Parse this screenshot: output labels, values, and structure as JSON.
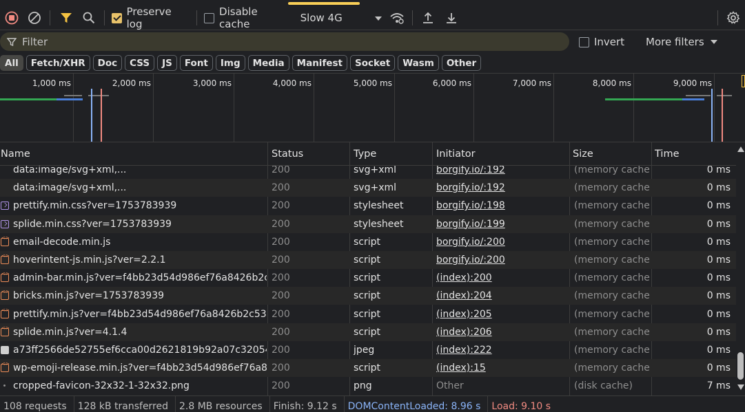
{
  "toolbar": {
    "preserve_log_label": "Preserve log",
    "disable_cache_label": "Disable cache",
    "throttle_value": "Slow 4G",
    "icons": [
      "stop-recording-icon",
      "clear-icon",
      "filter-icon",
      "search-icon",
      "network-conditions-icon",
      "import-icon",
      "export-icon",
      "settings-icon"
    ]
  },
  "filter": {
    "placeholder": "Filter",
    "invert_label": "Invert",
    "more_filters_label": "More filters"
  },
  "type_filters": [
    "All",
    "Fetch/XHR",
    "Doc",
    "CSS",
    "JS",
    "Font",
    "Img",
    "Media",
    "Manifest",
    "Socket",
    "Wasm",
    "Other"
  ],
  "overview": {
    "ticks": [
      "1,000 ms",
      "2,000 ms",
      "3,000 ms",
      "4,000 ms",
      "5,000 ms",
      "6,000 ms",
      "7,000 ms",
      "8,000 ms",
      "9,000 ms"
    ],
    "colors": {
      "green": "#34a853",
      "blue": "#4a7fd9",
      "domcontent": "#8ab4f8",
      "load": "#f28b82"
    }
  },
  "columns": {
    "name": "Name",
    "status": "Status",
    "type": "Type",
    "initiator": "Initiator",
    "size": "Size",
    "time": "Time"
  },
  "rows": [
    {
      "icon": "none",
      "name": "data:image/svg+xml,...",
      "status": "200",
      "type": "svg+xml",
      "initiator": "borgify.io/:192",
      "init_kind": "link",
      "size": "(memory cache)",
      "time": "0 ms"
    },
    {
      "icon": "none",
      "name": "data:image/svg+xml,...",
      "status": "200",
      "type": "svg+xml",
      "initiator": "borgify.io/:192",
      "init_kind": "link",
      "size": "(memory cache)",
      "time": "0 ms"
    },
    {
      "icon": "css",
      "name": "prettify.min.css?ver=1753783939",
      "status": "200",
      "type": "stylesheet",
      "initiator": "borgify.io/:198",
      "init_kind": "link",
      "size": "(memory cache)",
      "time": "0 ms"
    },
    {
      "icon": "css",
      "name": "splide.min.css?ver=1753783939",
      "status": "200",
      "type": "stylesheet",
      "initiator": "borgify.io/:199",
      "init_kind": "link",
      "size": "(memory cache)",
      "time": "0 ms"
    },
    {
      "icon": "js",
      "name": "email-decode.min.js",
      "status": "200",
      "type": "script",
      "initiator": "borgify.io/:200",
      "init_kind": "link",
      "size": "(memory cache)",
      "time": "0 ms"
    },
    {
      "icon": "js",
      "name": "hoverintent-js.min.js?ver=2.2.1",
      "status": "200",
      "type": "script",
      "initiator": "borgify.io/:200",
      "init_kind": "link",
      "size": "(memory cache)",
      "time": "0 ms"
    },
    {
      "icon": "js",
      "name": "admin-bar.min.js?ver=f4bb23d54d986ef76a8426b2c...",
      "status": "200",
      "type": "script",
      "initiator": "(index):200",
      "init_kind": "link",
      "size": "(memory cache)",
      "time": "0 ms"
    },
    {
      "icon": "js",
      "name": "bricks.min.js?ver=1753783939",
      "status": "200",
      "type": "script",
      "initiator": "(index):204",
      "init_kind": "link",
      "size": "(memory cache)",
      "time": "0 ms"
    },
    {
      "icon": "js",
      "name": "prettify.min.js?ver=f4bb23d54d986ef76a8426b2c534f...",
      "status": "200",
      "type": "script",
      "initiator": "(index):205",
      "init_kind": "link",
      "size": "(memory cache)",
      "time": "0 ms"
    },
    {
      "icon": "js",
      "name": "splide.min.js?ver=4.1.4",
      "status": "200",
      "type": "script",
      "initiator": "(index):206",
      "init_kind": "link",
      "size": "(memory cache)",
      "time": "0 ms"
    },
    {
      "icon": "img",
      "name": "a73ff2566de52755ef6cca00d2621819b92a07c320540...",
      "status": "200",
      "type": "jpeg",
      "initiator": "(index):222",
      "init_kind": "link",
      "size": "(memory cache)",
      "time": "0 ms"
    },
    {
      "icon": "js",
      "name": "wp-emoji-release.min.js?ver=f4bb23d54d986ef76a84...",
      "status": "200",
      "type": "script",
      "initiator": "(index):15",
      "init_kind": "link",
      "size": "(memory cache)",
      "time": "0 ms"
    },
    {
      "icon": "dot",
      "name": "cropped-favicon-32x32-1-32x32.png",
      "status": "200",
      "type": "png",
      "initiator": "Other",
      "init_kind": "other",
      "size": "(disk cache)",
      "time": "7 ms"
    }
  ],
  "status_bar": {
    "requests": "108 requests",
    "transferred": "128 kB transferred",
    "resources": "2.8 MB resources",
    "finish": "Finish: 9.12 s",
    "domcontentloaded": "DOMContentLoaded: 8.96 s",
    "load": "Load: 9.10 s",
    "domcontent_color": "#8ab4f8",
    "load_color": "#f28b82"
  }
}
